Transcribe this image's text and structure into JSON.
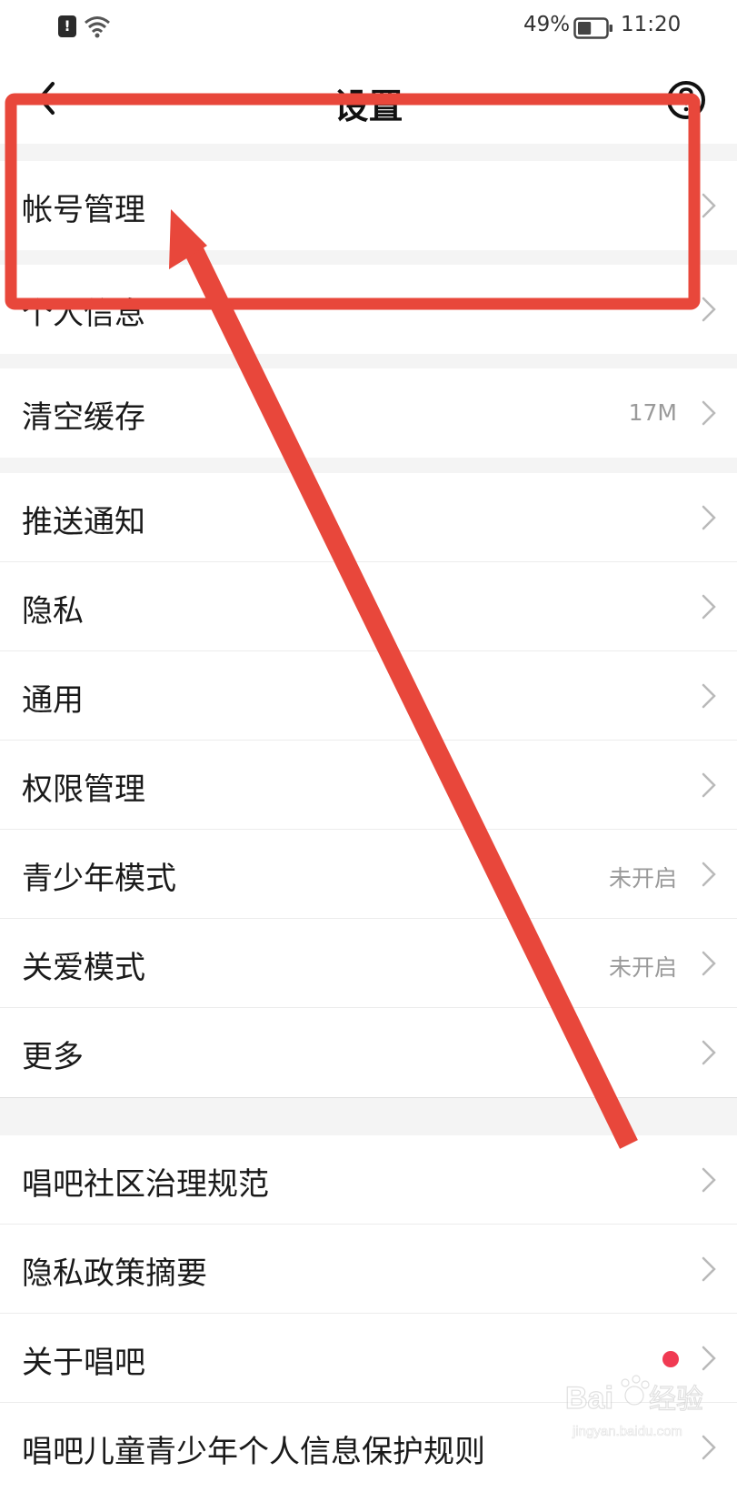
{
  "status_bar": {
    "battery": "49%",
    "time": "11:20",
    "alert_icon": "alert-icon",
    "wifi_icon": "wifi-icon",
    "battery_level": 0.49
  },
  "header": {
    "title": "设置",
    "back_icon": "chevron-left-icon",
    "help_icon": "help-icon"
  },
  "groups": [
    {
      "items": [
        {
          "label": "帐号管理"
        }
      ]
    },
    {
      "items": [
        {
          "label": "个人信息"
        }
      ]
    },
    {
      "items": [
        {
          "label": "清空缓存",
          "value": "17M"
        }
      ]
    },
    {
      "items": [
        {
          "label": "推送通知"
        },
        {
          "label": "隐私"
        },
        {
          "label": "通用"
        },
        {
          "label": "权限管理"
        },
        {
          "label": "青少年模式",
          "value": "未开启"
        },
        {
          "label": "关爱模式",
          "value": "未开启"
        },
        {
          "label": "更多"
        }
      ]
    },
    {
      "items": [
        {
          "label": "唱吧社区治理规范"
        },
        {
          "label": "隐私政策摘要"
        },
        {
          "label": "关于唱吧",
          "badge": "red-dot"
        },
        {
          "label": "唱吧儿童青少年个人信息保护规则"
        }
      ]
    }
  ],
  "annotation": {
    "color": "#e8473b"
  },
  "watermark": {
    "brand": "Baidu经验",
    "url": "jingyan.baidu.com"
  }
}
